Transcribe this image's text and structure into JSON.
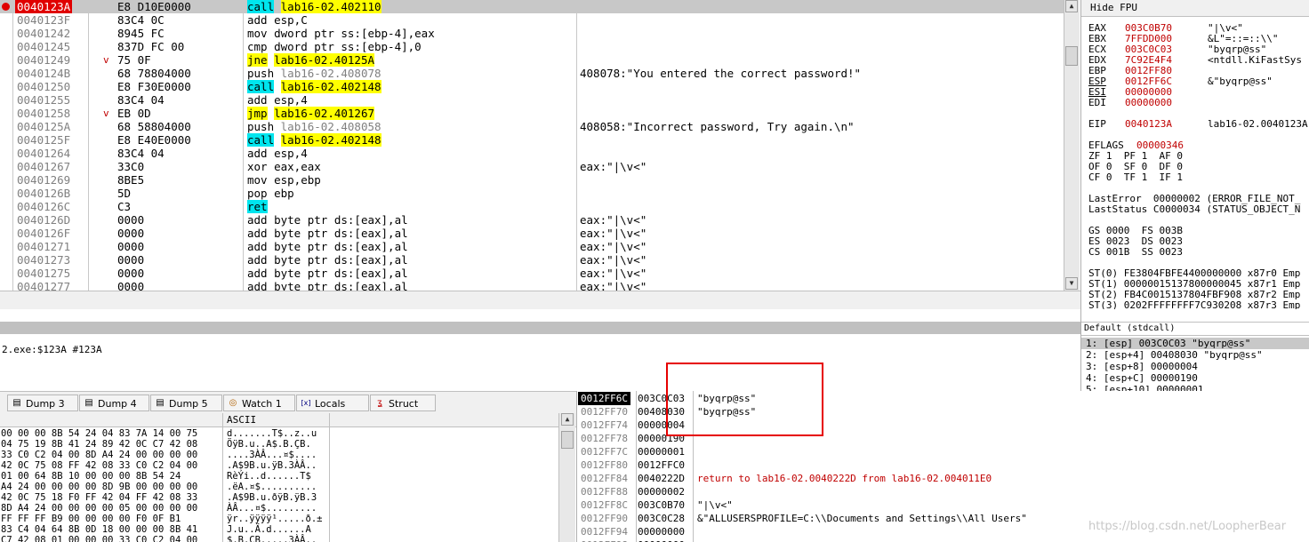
{
  "disasm": [
    {
      "addr": "0040123A",
      "hex": "E8 D10E0000",
      "mn": "call",
      "op": "lab16-02.402110",
      "mnhl": "c",
      "ophl": "y",
      "cur": true,
      "bp": true
    },
    {
      "addr": "0040123F",
      "hex": "83C4 0C",
      "mn": "add",
      "op": "esp,C"
    },
    {
      "addr": "00401242",
      "hex": "8945 FC",
      "mn": "mov",
      "op": "dword ptr ss:[ebp-4],eax"
    },
    {
      "addr": "00401245",
      "hex": "837D FC 00",
      "mn": "cmp",
      "op": "dword ptr ss:[ebp-4],0"
    },
    {
      "addr": "00401249",
      "arrow": "v",
      "hex": "75 0F",
      "mn": "jne",
      "op": "lab16-02.40125A",
      "mnhl": "y",
      "ophl": "y"
    },
    {
      "addr": "0040124B",
      "hex": "68 78804000",
      "mn": "push",
      "op": "lab16-02.408078",
      "comment": "408078:\"You entered the correct password!\""
    },
    {
      "addr": "00401250",
      "hex": "E8 F30E0000",
      "mn": "call",
      "op": "lab16-02.402148",
      "mnhl": "c",
      "ophl": "y"
    },
    {
      "addr": "00401255",
      "hex": "83C4 04",
      "mn": "add",
      "op": "esp,4"
    },
    {
      "addr": "00401258",
      "arrow": "v",
      "hex": "EB 0D",
      "mn": "jmp",
      "op": "lab16-02.401267",
      "mnhl": "y",
      "ophl": "y"
    },
    {
      "addr": "0040125A",
      "hex": "68 58804000",
      "mn": "push",
      "op": "lab16-02.408058",
      "comment": "408058:\"Incorrect password, Try again.\\n\""
    },
    {
      "addr": "0040125F",
      "hex": "E8 E40E0000",
      "mn": "call",
      "op": "lab16-02.402148",
      "mnhl": "c",
      "ophl": "y"
    },
    {
      "addr": "00401264",
      "hex": "83C4 04",
      "mn": "add",
      "op": "esp,4"
    },
    {
      "addr": "00401267",
      "hex": "33C0",
      "mn": "xor",
      "op": "eax,eax",
      "comment": "eax:\"|\\v<\""
    },
    {
      "addr": "00401269",
      "hex": "8BE5",
      "mn": "mov",
      "op": "esp,ebp"
    },
    {
      "addr": "0040126B",
      "hex": "5D",
      "mn": "pop",
      "op": "ebp"
    },
    {
      "addr": "0040126C",
      "hex": "C3",
      "mn": "ret",
      "op": "",
      "mnhl": "c"
    },
    {
      "addr": "0040126D",
      "hex": "0000",
      "mn": "add",
      "op": "byte ptr ds:[eax],al",
      "comment": "eax:\"|\\v<\""
    },
    {
      "addr": "0040126F",
      "hex": "0000",
      "mn": "add",
      "op": "byte ptr ds:[eax],al",
      "comment": "eax:\"|\\v<\""
    },
    {
      "addr": "00401271",
      "hex": "0000",
      "mn": "add",
      "op": "byte ptr ds:[eax],al",
      "comment": "eax:\"|\\v<\""
    },
    {
      "addr": "00401273",
      "hex": "0000",
      "mn": "add",
      "op": "byte ptr ds:[eax],al",
      "comment": "eax:\"|\\v<\""
    },
    {
      "addr": "00401275",
      "hex": "0000",
      "mn": "add",
      "op": "byte ptr ds:[eax],al",
      "comment": "eax:\"|\\v<\""
    },
    {
      "addr": "00401277",
      "hex": "0000",
      "mn": "add",
      "op": "byte ptr ds:[eax],al",
      "comment": "eax:\"|\\v<\""
    }
  ],
  "registers": {
    "header": "Hide FPU",
    "gp": [
      {
        "n": "EAX",
        "v": "003C0B70",
        "c": "\"|\\v<\""
      },
      {
        "n": "EBX",
        "v": "7FFDD000",
        "c": "&L\"=::=::\\\\\""
      },
      {
        "n": "ECX",
        "v": "003C0C03",
        "c": "\"byqrp@ss\""
      },
      {
        "n": "EDX",
        "v": "7C92E4F4",
        "c": "<ntdll.KiFastSys"
      },
      {
        "n": "EBP",
        "v": "0012FF80",
        "c": ""
      },
      {
        "n": "ESP",
        "v": "0012FF6C",
        "c": "&\"byqrp@ss\""
      },
      {
        "n": "ESI",
        "v": "00000000",
        "c": ""
      },
      {
        "n": "EDI",
        "v": "00000000",
        "c": ""
      }
    ],
    "eip": {
      "n": "EIP",
      "v": "0040123A",
      "c": "lab16-02.0040123A"
    },
    "eflags": {
      "n": "EFLAGS",
      "v": "00000346"
    },
    "flags": [
      "ZF 1  PF 1  AF 0",
      "OF 0  SF 0  DF 0",
      "CF 0  TF 1  IF 1"
    ],
    "last": [
      "LastError  00000002 (ERROR_FILE_NOT_",
      "LastStatus C0000034 (STATUS_OBJECT_N"
    ],
    "segs": [
      "GS 0000  FS 003B",
      "ES 0023  DS 0023",
      "CS 001B  SS 0023"
    ],
    "fpu": [
      "ST(0) FE3804FBFE4400000000 x87r0 Emp",
      "ST(1) 00000015137800000045 x87r1 Emp",
      "ST(2) FB4C0015137804FBF908 x87r2 Emp",
      "ST(3) 0202FFFFFFFF7C930208 x87r3 Emp"
    ]
  },
  "info": {
    "line": "2.exe:$123A #123A"
  },
  "callstack": {
    "title": "Default (stdcall)",
    "rows": [
      "1: [esp] 003C0C03 \"byqrp@ss\"",
      "2: [esp+4] 00408030 \"byqrp@ss\"",
      "3: [esp+8] 00000004",
      "4: [esp+C] 00000190",
      "5: [esp+10] 00000001"
    ]
  },
  "tabs": [
    {
      "label": "Dump 3",
      "icon": "dump-icon"
    },
    {
      "label": "Dump 4",
      "icon": "dump-icon"
    },
    {
      "label": "Dump 5",
      "icon": "dump-icon"
    },
    {
      "label": "Watch 1",
      "icon": "watch-icon"
    },
    {
      "label": "Locals",
      "icon": "locals-icon"
    },
    {
      "label": "Struct",
      "icon": "struct-icon"
    }
  ],
  "dump": {
    "ascii_header": "ASCII",
    "rows": [
      {
        "h": "00 00 00 8B 54 24 04 83 7A 14 00 75",
        "a": "d.......T$..z..u"
      },
      {
        "h": "04 75 19 8B 41 24 89 42 0C C7 42 08",
        "a": "ÖÿB.u..A$.B.ÇB."
      },
      {
        "h": "33 C0 C2 04 00 8D A4 24 00 00 00 00",
        "a": "....3ÀÂ...¤$...."
      },
      {
        "h": "42 0C 75 08 FF 42 08 33 C0 C2 04 00",
        "a": ".A$9B.u.ÿB.3ÀÂ.."
      },
      {
        "h": "01 00 64 8B 10 00 00 00 8B 54 24",
        "a": "RèÝi..d......T$"
      },
      {
        "h": "A4 24 00 00 00 00 8D 9B 00 00 00 00",
        "a": ".ëA.¤$.........."
      },
      {
        "h": "42 0C 75 18 F0 FF 42 04 FF 42 08 33",
        "a": ".A$9B.u.ðÿB.ÿB.3"
      },
      {
        "h": "8D A4 24 00 00 00 00 05 00 00 00 00",
        "a": "ÀÂ...¤$........."
      },
      {
        "h": "FF FF FF B9 00 00 00 00 F0 0F B1",
        "a": "ÿr..ÿÿÿÿ¹.....ð.±"
      },
      {
        "h": "83 C4 04 64 8B 0D 18 00 00 00 8B 41",
        "a": "J.u..Ä.d......A"
      },
      {
        "h": "C7 42 08 01 00 00 00 33 C0 C2 04 00",
        "a": "$.B.ÇB.....3ÀÂ.."
      },
      {
        "h": "90 F3 90 83 7A 04 FF 74 C5 FF 0C",
        "a": ".z..ó..z.ÿtÅÿ."
      }
    ]
  },
  "stack": [
    {
      "a": "0012FF6C",
      "v": "003C0C03",
      "c": "\"byqrp@ss\"",
      "sel": true
    },
    {
      "a": "0012FF70",
      "v": "00408030",
      "c": "\"byqrp@ss\""
    },
    {
      "a": "0012FF74",
      "v": "00000004",
      "c": ""
    },
    {
      "a": "0012FF78",
      "v": "00000190",
      "c": ""
    },
    {
      "a": "0012FF7C",
      "v": "00000001",
      "c": ""
    },
    {
      "a": "0012FF80",
      "v": "0012FFC0",
      "c": ""
    },
    {
      "a": "0012FF84",
      "v": "0040222D",
      "c": "return to lab16-02.0040222D from lab16-02.004011E0",
      "ret": true
    },
    {
      "a": "0012FF88",
      "v": "00000002",
      "c": ""
    },
    {
      "a": "0012FF8C",
      "v": "003C0B70",
      "c": "\"|\\v<\""
    },
    {
      "a": "0012FF90",
      "v": "003C0C28",
      "c": "&\"ALLUSERSPROFILE=C:\\\\Documents and Settings\\\\All Users\""
    },
    {
      "a": "0012FF94",
      "v": "00000000",
      "c": ""
    },
    {
      "a": "0012FF98",
      "v": "00000000",
      "c": ""
    },
    {
      "a": "0012FF9C",
      "v": "7FFDD000",
      "c": "&L\"=::=::\\\\\""
    }
  ],
  "watermark": "https://blog.csdn.net/LoopherBear"
}
